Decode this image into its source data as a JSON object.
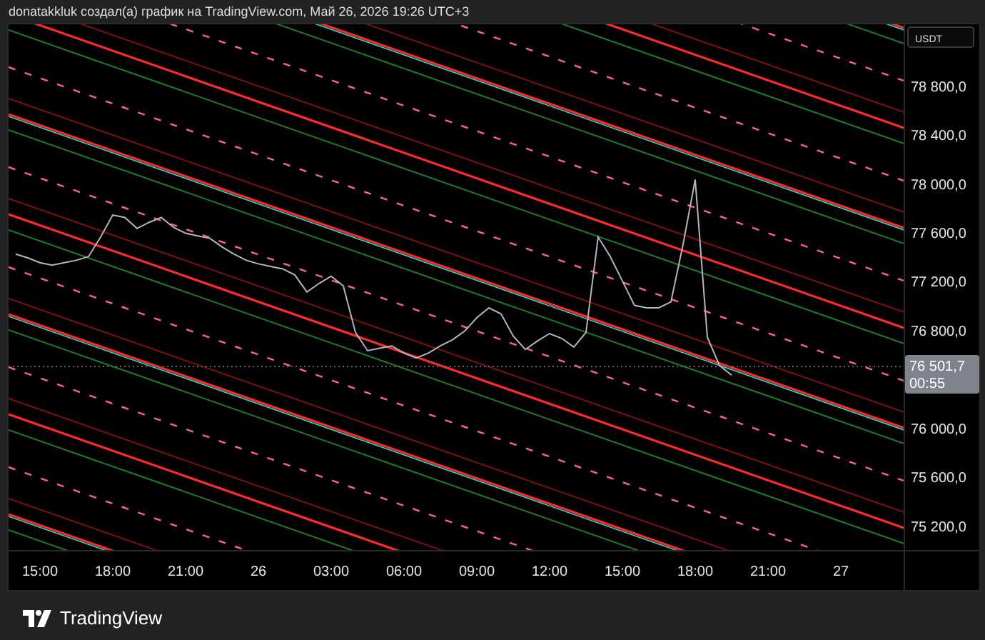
{
  "header": {
    "title": "donatakkluk создал(а) график на TradingView.com, Май 26, 2026 19:26 UTC+3"
  },
  "chart": {
    "currency": "USDT",
    "last_price": "76 501,7",
    "countdown": "00:55",
    "chart_data": {
      "type": "line",
      "categories": [
        null,
        null,
        "15:00",
        null,
        null,
        null,
        null,
        null,
        "18:00",
        null,
        null,
        null,
        null,
        null,
        "21:00",
        null,
        null,
        null,
        null,
        null,
        "26",
        null,
        null,
        null,
        null,
        null,
        "03:00",
        null,
        null,
        null,
        null,
        null,
        "06:00",
        null,
        null,
        null,
        null,
        null,
        "09:00",
        null,
        null,
        null,
        null,
        null,
        "12:00",
        null,
        null,
        null,
        null,
        null,
        "15:00",
        null,
        null,
        null,
        null,
        null,
        "18:00",
        null,
        null,
        null,
        null,
        null,
        "21:00",
        null,
        null,
        null,
        null,
        null,
        "27",
        null,
        null,
        null,
        null
      ],
      "series": [
        {
          "color": "#b2b5be",
          "values": [
            77420,
            77390,
            77350,
            77330,
            77350,
            77370,
            77400,
            77560,
            77740,
            77720,
            77630,
            77680,
            77720,
            77640,
            77590,
            77570,
            77550,
            77480,
            77420,
            77370,
            77340,
            77320,
            77300,
            77250,
            77110,
            77180,
            77240,
            77160,
            76780,
            76630,
            76650,
            76670,
            76610,
            76570,
            76610,
            76670,
            76720,
            76790,
            76900,
            76980,
            76930,
            76750,
            76640,
            76710,
            76770,
            76730,
            76660,
            76780,
            77560,
            77400,
            77200,
            77000,
            76980,
            76980,
            77030,
            77500,
            78030,
            76740,
            76510,
            76430,
            null,
            null,
            null,
            null,
            null,
            null,
            null,
            null,
            null,
            null,
            null,
            null,
            null
          ]
        }
      ],
      "ylim": [
        75000,
        79300
      ],
      "ref_lines": [
        {
          "axis": "y",
          "value": 76501.7
        }
      ],
      "yticks": [
        {
          "value": 75200,
          "label": "75 200,0"
        },
        {
          "value": 75600,
          "label": "75 600,0"
        },
        {
          "value": 76000,
          "label": "76 000,0"
        },
        {
          "value": 76800,
          "label": "76 800,0"
        },
        {
          "value": 77200,
          "label": "77 200,0"
        },
        {
          "value": 77600,
          "label": "77 600,0"
        },
        {
          "value": 78000,
          "label": "78 000,0"
        },
        {
          "value": 78400,
          "label": "78 400,0"
        },
        {
          "value": 78800,
          "label": "78 800,0"
        }
      ]
    }
  },
  "footer": {
    "brand": "TradingView"
  }
}
